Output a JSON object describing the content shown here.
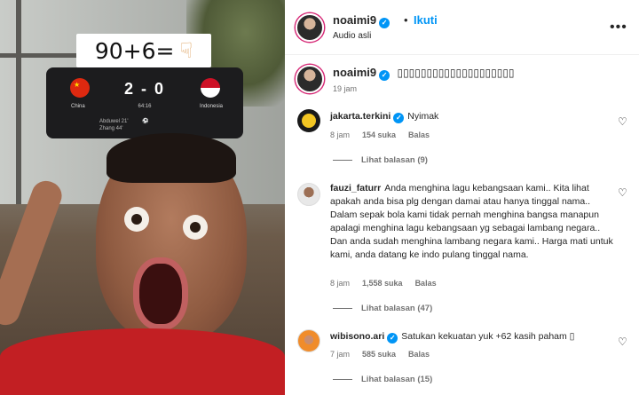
{
  "media": {
    "overlay_text": "90+6=",
    "scoreboard": {
      "home_team": "China",
      "away_team": "Indonesia",
      "score": "2 - 0",
      "clock": "64:16",
      "scorers": [
        "Abduwel 21'",
        "Zhang 44'"
      ]
    }
  },
  "header": {
    "username": "noaimi9",
    "dot": "•",
    "follow_label": "Ikuti",
    "audio_label": "Audio asli",
    "more_icon": "more-horizontal-icon"
  },
  "caption": {
    "username": "noaimi9",
    "text": "▯▯▯▯▯▯▯▯▯▯▯▯▯▯▯▯▯▯▯▯",
    "time": "19 jam"
  },
  "comments": [
    {
      "username": "jakarta.terkini",
      "verified": true,
      "text": "Nyimak",
      "time": "8 jam",
      "likes": "154 suka",
      "reply_label": "Balas",
      "view_replies": "Lihat balasan (9)"
    },
    {
      "username": "fauzi_faturr",
      "verified": false,
      "text": "Anda menghina lagu kebangsaan kami.. Kita lihat apakah anda bisa plg dengan damai atau hanya tinggal nama.. Dalam sepak bola kami tidak pernah menghina bangsa manapun apalagi menghina lagu kebangsaan yg sebagai lambang negara.. Dan anda sudah menghina lambang negara kami.. Harga mati untuk kami, anda datang ke indo pulang tinggal nama.",
      "time": "8 jam",
      "likes": "1,558 suka",
      "reply_label": "Balas",
      "view_replies": "Lihat balasan (47)"
    },
    {
      "username": "wibisono.ari",
      "verified": true,
      "text": "Satukan kekuatan yuk +62 kasih paham ▯",
      "time": "7 jam",
      "likes": "585 suka",
      "reply_label": "Balas",
      "view_replies": "Lihat balasan (15)"
    }
  ],
  "colors": {
    "accent": "#0095f6",
    "text": "#262626",
    "muted": "#737373",
    "shirt": "#c21f23"
  }
}
